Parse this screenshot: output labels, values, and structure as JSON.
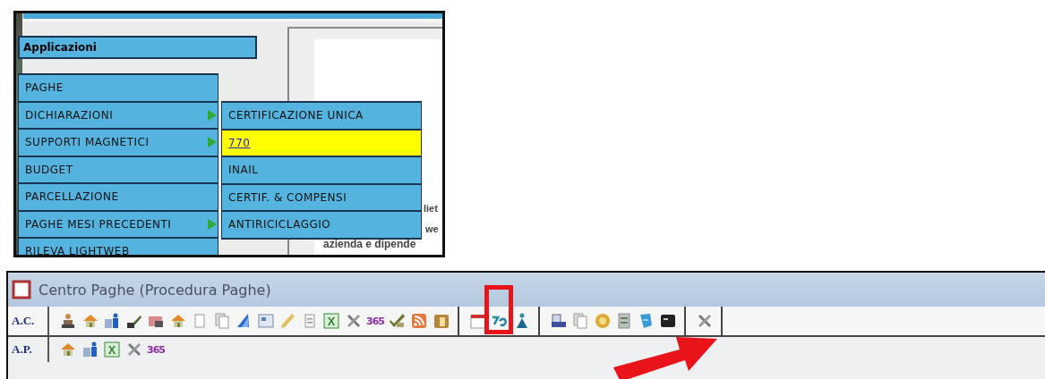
{
  "menu_screenshot": {
    "header": "Applicazioni",
    "menu": [
      {
        "label": "PAGHE",
        "has_submenu": false
      },
      {
        "label": "DICHIARAZIONI",
        "has_submenu": true
      },
      {
        "label": "SUPPORTI MAGNETICI",
        "has_submenu": true
      },
      {
        "label": "BUDGET",
        "has_submenu": false
      },
      {
        "label": "PARCELLAZIONE",
        "has_submenu": false
      },
      {
        "label": "PAGHE MESI PRECEDENTI",
        "has_submenu": true
      },
      {
        "label": "RILEVA LIGHTWEB",
        "has_submenu": false
      }
    ],
    "submenu": [
      {
        "label": "CERTIFICAZIONE UNICA",
        "selected": false
      },
      {
        "label": "770",
        "selected": true
      },
      {
        "label": "INAIL",
        "selected": false
      },
      {
        "label": "CERTIF. & COMPENSI",
        "selected": false
      },
      {
        "label": "ANTIRICICLAGGIO",
        "selected": false
      }
    ],
    "page_fragments": [
      "liet",
      "we",
      "azienda e dipende"
    ]
  },
  "toolbar_screenshot": {
    "title": "Centro Paghe (Procedura Paghe)",
    "toolbars": [
      {
        "label": "A.C.",
        "groups": [
          [
            {
              "kind": "people",
              "highlighted": false
            },
            {
              "kind": "house",
              "highlighted": false
            },
            {
              "kind": "building",
              "highlighted": false
            },
            {
              "kind": "pen",
              "highlighted": false
            },
            {
              "kind": "card",
              "highlighted": false
            },
            {
              "kind": "house",
              "highlighted": false
            },
            {
              "kind": "page",
              "highlighted": false
            },
            {
              "kind": "pages",
              "highlighted": false
            },
            {
              "kind": "sail",
              "highlighted": false
            },
            {
              "kind": "image",
              "highlighted": false
            },
            {
              "kind": "pencil",
              "highlighted": false
            },
            {
              "kind": "document",
              "highlighted": false
            },
            {
              "kind": "spreadsheet",
              "highlighted": false
            },
            {
              "kind": "tools",
              "highlighted": false
            },
            {
              "kind": "text",
              "label": "365",
              "highlighted": false
            },
            {
              "kind": "check",
              "highlighted": false
            },
            {
              "kind": "rss",
              "highlighted": false
            },
            {
              "kind": "box",
              "highlighted": false
            }
          ],
          [
            {
              "kind": "calendar",
              "highlighted": false
            },
            {
              "kind": "wave",
              "highlighted": true
            },
            {
              "kind": "figure",
              "highlighted": false
            }
          ],
          [
            {
              "kind": "scanner",
              "highlighted": false
            },
            {
              "kind": "pages",
              "highlighted": false
            },
            {
              "kind": "gear",
              "highlighted": false
            },
            {
              "kind": "list",
              "highlighted": false
            },
            {
              "kind": "book",
              "highlighted": false
            },
            {
              "kind": "terminal",
              "highlighted": false
            }
          ],
          [
            {
              "kind": "tools",
              "highlighted": false
            }
          ]
        ]
      },
      {
        "label": "A.P.",
        "groups": [
          [
            {
              "kind": "house",
              "highlighted": false
            },
            {
              "kind": "building",
              "highlighted": false
            },
            {
              "kind": "spreadsheet",
              "highlighted": false
            },
            {
              "kind": "tools",
              "highlighted": false
            },
            {
              "kind": "text",
              "label": "365",
              "highlighted": false
            }
          ]
        ]
      }
    ]
  }
}
